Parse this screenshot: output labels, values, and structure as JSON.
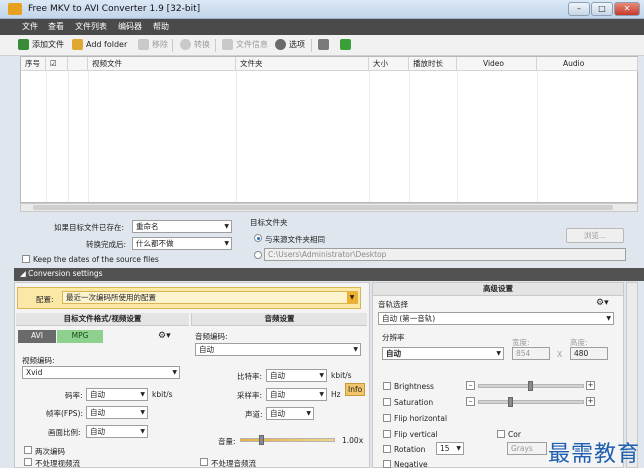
{
  "window": {
    "title": "Free MKV to AVI Converter 1.9  [32-bit]",
    "min": "–",
    "max": "□",
    "close": "✕"
  },
  "menu": [
    "文件",
    "查看",
    "文件列表",
    "编码器",
    "帮助"
  ],
  "toolbar": {
    "add_file": "添加文件",
    "add_folder": "Add folder",
    "remove": "移除",
    "convert": "转换",
    "file_info": "文件信息",
    "options": "选项"
  },
  "columns": [
    "序号",
    "☑",
    "视频文件",
    "文件夹",
    "大小",
    "播放时长",
    "Video",
    "Audio"
  ],
  "options": {
    "if_exists_label": "如果目标文件已存在:",
    "if_exists_value": "重命名",
    "after_convert_label": "转换完成后:",
    "after_convert_value": "什么都不做",
    "keep_dates": "Keep the dates of the source files",
    "target_folder_label": "目标文件夹",
    "same_as_source": "与来源文件夹相同",
    "custom_path": "C:\\Users\\Administrator\\Desktop",
    "browse": "浏览..."
  },
  "conversion": {
    "section_title": "◢ Conversion settings",
    "config_label": "配置:",
    "config_value": "最近一次编码所使用的配置",
    "format_title": "目标文件格式/视频设置",
    "tab_avi": "AVI",
    "tab_mpg": "MPG",
    "video_codec_label": "视频编码:",
    "video_codec": "Xvid",
    "bitrate_label": "码率:",
    "bitrate": "自动",
    "bitrate_unit": "kbit/s",
    "fps_label": "帧率(FPS):",
    "fps": "自动",
    "aspect_label": "画面比例:",
    "aspect": "自动",
    "two_pass": "两次编码",
    "no_video": "不处理视频流",
    "audio_title": "音频设置",
    "audio_codec_label": "音频编码:",
    "audio_codec": "自动",
    "a_bitrate_label": "比特率:",
    "a_bitrate": "自动",
    "a_bitrate_unit": "kbit/s",
    "samplerate_label": "采样率:",
    "samplerate": "自动",
    "samplerate_unit": "Hz",
    "channels_label": "声道:",
    "channels": "自动",
    "info": "Info",
    "volume_label": "音量:",
    "volume": "1.00x",
    "volume_level": 0.2,
    "no_audio": "不处理音频流"
  },
  "advanced": {
    "title": "高级设置",
    "track_label": "音轨选择",
    "track_value": "自动 (第一音轨)",
    "resolution_label": "分辨率",
    "resolution_value": "自动",
    "width_label": "宽度:",
    "width": "854",
    "height_label": "高度:",
    "height": "480",
    "x": "X",
    "brightness": "Brightness",
    "saturation": "Saturation",
    "flip_h": "Flip horizontal",
    "flip_v": "Flip vertical",
    "rotation": "Rotation",
    "rotation_value": "15",
    "negative": "Negative",
    "contrast_partial": "Cor",
    "grays_partial": "Grays"
  },
  "watermark": "最需教育"
}
